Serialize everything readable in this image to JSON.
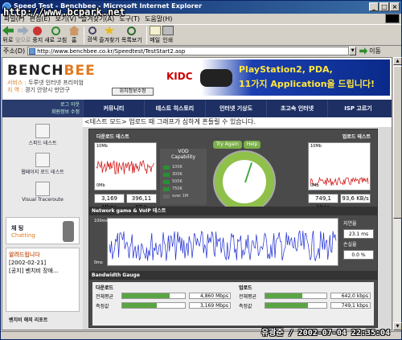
{
  "window": {
    "title": "Speed Test - Benchbee - Microsoft Internet Explorer"
  },
  "watermark": {
    "url": "http://www.bcpark.net",
    "credit": "유광준 / 2002-07-04 22:35:04"
  },
  "menu": [
    "파일(F)",
    "편집(E)",
    "보기(V)",
    "즐겨찾기(A)",
    "도구(T)",
    "도움말(H)"
  ],
  "toolbar": {
    "back": "뒤로",
    "forward": "앞으로",
    "stop": "중지",
    "refresh": "새로 고침",
    "home": "홈",
    "search": "검색",
    "favorites": "즐겨찾기",
    "history": "목록보기",
    "mail": "메일",
    "print": "인쇄"
  },
  "address": {
    "label": "주소(D)",
    "url": "http://www.benchbee.co.kr/Speedtest/TestStart2.asp",
    "go_label": "이동"
  },
  "site": {
    "logo_bench": "BENCH",
    "logo_bee": "BEE",
    "service_label": "서비스 :",
    "service_value": "두루넷 인터넷 프리미엄",
    "region_label": "지  역 :",
    "region_value": "경기 안양시 만안구",
    "location_button": "위치정보수정"
  },
  "banner": {
    "brand": "KIDC",
    "line1": "PlayStation2, PDA,",
    "line2": "11가지 Application을 드립니다!"
  },
  "nav": {
    "login": "로그 아웃",
    "member": "회원정보 수정",
    "tabs": [
      "커뮤니티",
      "테스트 히스토리",
      "인터넷 기상도",
      "초고속 인터넷",
      "ISP 고르기"
    ]
  },
  "sidebar": {
    "items": [
      "스피드 테스트",
      "웹페이지 로드 테스트",
      "Visual Traceroute"
    ],
    "chat_label": "채 팅",
    "chat_sub": "Chatting",
    "notice_title": "알려드립니다",
    "notice_date": "[2002-02-21]",
    "notice_text": "[공지] 벤치비 장애...",
    "bottom_label": "벤치비 해외 리포트"
  },
  "marquee": "<테스트 모드> 업로드 때 그래프가 심하게 흔들릴 수 있습니다.",
  "download_test": {
    "title": "다운로드 테스트",
    "ymax": "10Mb",
    "ymin": "0Mb",
    "mbps": "3,169 Mbps",
    "kbs": "396,11 KB/s"
  },
  "upload_test": {
    "title": "업로드 테스트",
    "ymax": "10Mb",
    "ymin": "0Mb",
    "kbps": "749,1 kbps",
    "kbs": "93,6 KB/s"
  },
  "vod": {
    "title": "VOD",
    "subtitle": "Capability",
    "levels": [
      "100K",
      "300K",
      "500K",
      "750K",
      "over 1M"
    ]
  },
  "gauge": {
    "try_again": "Try Again",
    "help": "Help",
    "level_fraction": 0.7
  },
  "network_test": {
    "title": "Network game & VoIP 테스트",
    "ymax": "100ms",
    "ymin": "0ms",
    "latency_label": "지연율",
    "latency_value": "23.1 ms",
    "loss_label": "손실율",
    "loss_value": "0.0 %"
  },
  "bandwidth": {
    "title": "Bandwidth Gauge",
    "download_title": "다운로드",
    "upload_title": "업로드",
    "avg_label": "전체평균",
    "measured_label": "측정값",
    "down_avg": "4,860 Mbps",
    "down_measured": "3,169 Mbps",
    "up_avg": "642,0 kbps",
    "up_measured": "749,1 kbps",
    "down_avg_fraction": 0.75,
    "down_measured_fraction": 0.55,
    "up_avg_fraction": 0.6,
    "up_measured_fraction": 0.7
  },
  "colors": {
    "nav_bg": "#1d2f63",
    "accent": "#e07a1f",
    "graph_download": "#d41c1c",
    "graph_network": "#1b2ad0",
    "gauge_green": "#8fc04a"
  }
}
